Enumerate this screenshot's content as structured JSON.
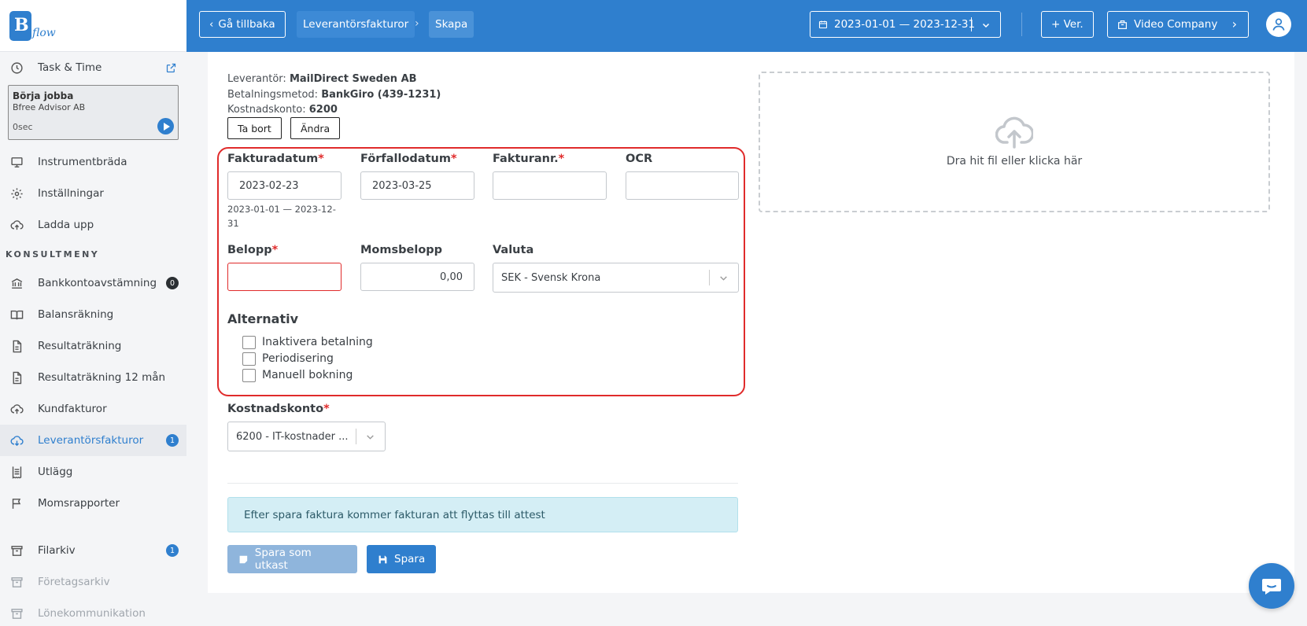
{
  "brand": {
    "logo_text": "flow",
    "accent": "#2f7fce"
  },
  "sidebar": {
    "task": {
      "label": "Task & Time",
      "title": "Börja jobba",
      "subtitle": "Bfree Advisor AB",
      "timer": "0sec"
    },
    "items_top": [
      {
        "label": "Instrumentbräda",
        "icon": "monitor-icon"
      },
      {
        "label": "Inställningar",
        "icon": "gear-icon"
      },
      {
        "label": "Ladda upp",
        "icon": "cloud-upload-icon"
      }
    ],
    "section_label": "KONSULTMENY",
    "items": [
      {
        "label": "Bankkontoavstämning",
        "icon": "bank-icon",
        "badge": "0"
      },
      {
        "label": "Balansräkning",
        "icon": "book-icon"
      },
      {
        "label": "Resultaträkning",
        "icon": "document-icon"
      },
      {
        "label": "Resultaträkning 12 mån",
        "icon": "document-icon"
      },
      {
        "label": "Kundfakturor",
        "icon": "cloud-upload-icon"
      },
      {
        "label": "Leverantörsfakturor",
        "icon": "cloud-download-icon",
        "badge": "1",
        "active": true
      },
      {
        "label": "Utlägg",
        "icon": "receipt-icon"
      },
      {
        "label": "Momsrapporter",
        "icon": "flag-icon"
      }
    ],
    "items_bottom": [
      {
        "label": "Filarkiv",
        "icon": "archive-icon",
        "badge": "1"
      },
      {
        "label": "Företagsarkiv",
        "icon": "archive-icon",
        "disabled": true
      },
      {
        "label": "Lönekommunikation",
        "icon": "archive-icon",
        "disabled": true
      }
    ]
  },
  "topbar": {
    "back_label": "Gå tillbaka",
    "breadcrumb": [
      "Leverantörsfakturor",
      "Skapa"
    ],
    "date_range": "2023-01-01 — 2023-12-31",
    "ver_label": "+ Ver.",
    "company_label": "Video Company"
  },
  "supplier": {
    "supplier_label": "Leverantör:",
    "supplier_value": "MailDirect Sweden AB",
    "payment_label": "Betalningsmetod:",
    "payment_value": "BankGiro (439-1231)",
    "account_label": "Kostnadskonto:",
    "account_value": "6200",
    "remove_button": "Ta bort",
    "change_button": "Ändra"
  },
  "form": {
    "invoice_date": {
      "label": "Fakturadatum",
      "value": "2023-02-23",
      "hint": "2023-01-01 — 2023-12-31"
    },
    "due_date": {
      "label": "Förfallodatum",
      "value": "2023-03-25"
    },
    "invoice_no": {
      "label": "Fakturanr.",
      "value": ""
    },
    "ocr": {
      "label": "OCR",
      "value": ""
    },
    "amount": {
      "label": "Belopp",
      "value": ""
    },
    "vat_amount": {
      "label": "Momsbelopp",
      "value": "0,00"
    },
    "currency": {
      "label": "Valuta",
      "value": "SEK - Svensk Krona"
    },
    "required_mark": "*",
    "options_title": "Alternativ",
    "options": [
      "Inaktivera betalning",
      "Periodisering",
      "Manuell bokning"
    ],
    "cost_account": {
      "label": "Kostnadskonto",
      "value": "6200 - IT-kostnader ..."
    }
  },
  "info_message": "Efter spara faktura kommer fakturan att flyttas till attest",
  "actions": {
    "draft_label": "Spara som utkast",
    "save_label": "Spara"
  },
  "dropzone": {
    "text": "Dra hit fil eller klicka här"
  }
}
